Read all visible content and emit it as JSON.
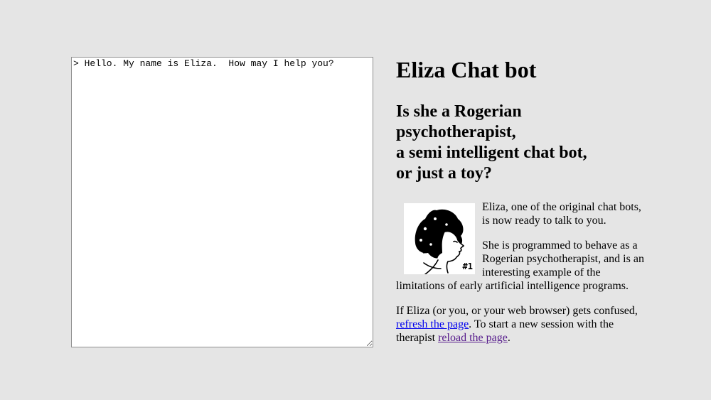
{
  "chat": {
    "transcript": "> Hello. My name is Eliza.  How may I help you?"
  },
  "info": {
    "title": "Eliza Chat bot",
    "subtitle_lines": [
      "Is she a Rogerian",
      "psychotherapist,",
      "a semi intelligent chat bot,",
      "or just a toy?"
    ],
    "portrait_tag": "#1",
    "para1": "Eliza, one of the original chat bots, is now ready to talk to you.",
    "para2": "She is programmed to behave as a Rogerian psychotherapist, and is an interesting example of the limitations of early artificial intelligence programs.",
    "para3_before": "If Eliza (or you, or your web browser) gets confused, ",
    "refresh_link": "refresh the page",
    "para3_middle": ". To start a new session with the therapist ",
    "reload_link": "reload the page",
    "para3_after": "."
  },
  "colors": {
    "page_background": "#e5e5e5",
    "link": "#0000ee",
    "visited_link": "#551a8b"
  }
}
